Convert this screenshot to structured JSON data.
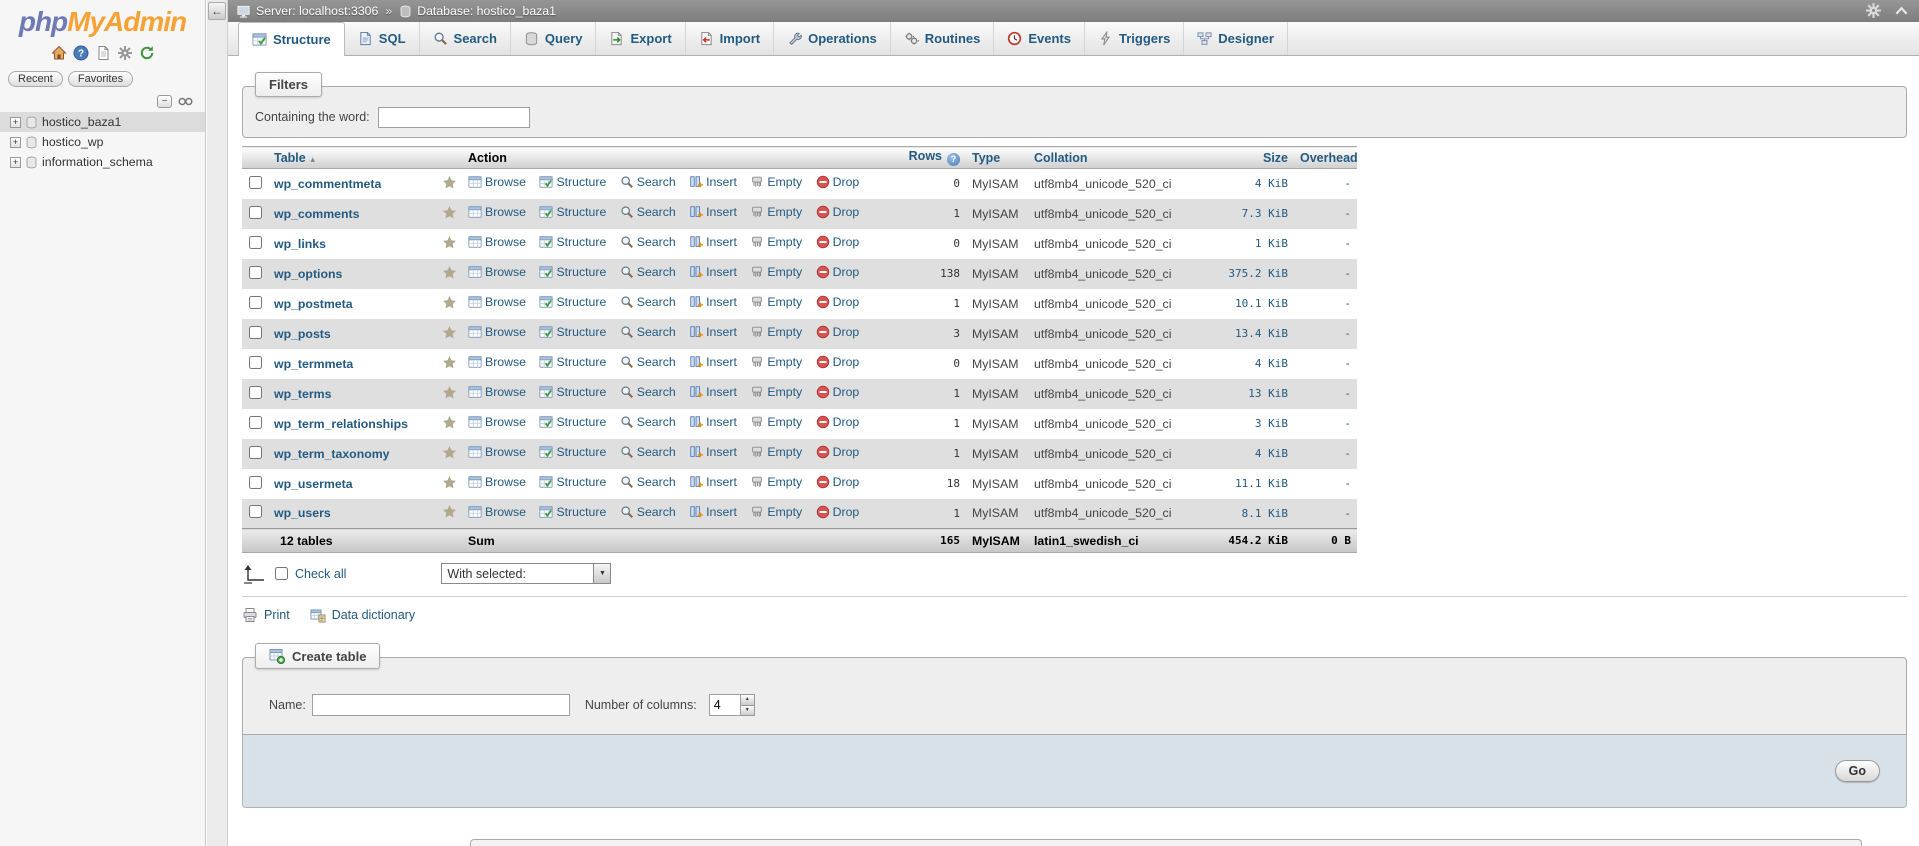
{
  "sidebar": {
    "logo": {
      "php": "php",
      "myadmin": "MyAdmin"
    },
    "buttons": {
      "recent": "Recent",
      "favorites": "Favorites"
    },
    "tools": {
      "collapse_glyph": "−"
    },
    "tree": [
      {
        "label": "hostico_baza1",
        "expander": "+",
        "selected": true
      },
      {
        "label": "hostico_wp",
        "expander": "+",
        "selected": false
      },
      {
        "label": "information_schema",
        "expander": "+",
        "selected": false
      }
    ]
  },
  "topbar": {
    "back_glyph": "←",
    "server": "Server: localhost:3306",
    "separator": "»",
    "database": "Database: hostico_baza1"
  },
  "tabs": [
    {
      "label": "Structure",
      "active": true
    },
    {
      "label": "SQL"
    },
    {
      "label": "Search"
    },
    {
      "label": "Query"
    },
    {
      "label": "Export"
    },
    {
      "label": "Import"
    },
    {
      "label": "Operations"
    },
    {
      "label": "Routines"
    },
    {
      "label": "Events"
    },
    {
      "label": "Triggers"
    },
    {
      "label": "Designer"
    }
  ],
  "filters": {
    "legend": "Filters",
    "label": "Containing the word:",
    "input_value": ""
  },
  "table": {
    "headers": {
      "table": "Table",
      "action": "Action",
      "rows": "Rows",
      "type": "Type",
      "collation": "Collation",
      "size": "Size",
      "overhead": "Overhead"
    },
    "sort_asc_glyph": "▲",
    "rows_help_glyph": "?",
    "action_labels": [
      "Browse",
      "Structure",
      "Search",
      "Insert",
      "Empty",
      "Drop"
    ],
    "rows": [
      {
        "name": "wp_commentmeta",
        "rows": "0",
        "type": "MyISAM",
        "collation": "utf8mb4_unicode_520_ci",
        "size": "4 KiB",
        "overhead": "-"
      },
      {
        "name": "wp_comments",
        "rows": "1",
        "type": "MyISAM",
        "collation": "utf8mb4_unicode_520_ci",
        "size": "7.3 KiB",
        "overhead": "-"
      },
      {
        "name": "wp_links",
        "rows": "0",
        "type": "MyISAM",
        "collation": "utf8mb4_unicode_520_ci",
        "size": "1 KiB",
        "overhead": "-"
      },
      {
        "name": "wp_options",
        "rows": "138",
        "type": "MyISAM",
        "collation": "utf8mb4_unicode_520_ci",
        "size": "375.2 KiB",
        "overhead": "-"
      },
      {
        "name": "wp_postmeta",
        "rows": "1",
        "type": "MyISAM",
        "collation": "utf8mb4_unicode_520_ci",
        "size": "10.1 KiB",
        "overhead": "-"
      },
      {
        "name": "wp_posts",
        "rows": "3",
        "type": "MyISAM",
        "collation": "utf8mb4_unicode_520_ci",
        "size": "13.4 KiB",
        "overhead": "-"
      },
      {
        "name": "wp_termmeta",
        "rows": "0",
        "type": "MyISAM",
        "collation": "utf8mb4_unicode_520_ci",
        "size": "4 KiB",
        "overhead": "-"
      },
      {
        "name": "wp_terms",
        "rows": "1",
        "type": "MyISAM",
        "collation": "utf8mb4_unicode_520_ci",
        "size": "13 KiB",
        "overhead": "-"
      },
      {
        "name": "wp_term_relationships",
        "rows": "1",
        "type": "MyISAM",
        "collation": "utf8mb4_unicode_520_ci",
        "size": "3 KiB",
        "overhead": "-"
      },
      {
        "name": "wp_term_taxonomy",
        "rows": "1",
        "type": "MyISAM",
        "collation": "utf8mb4_unicode_520_ci",
        "size": "4 KiB",
        "overhead": "-"
      },
      {
        "name": "wp_usermeta",
        "rows": "18",
        "type": "MyISAM",
        "collation": "utf8mb4_unicode_520_ci",
        "size": "11.1 KiB",
        "overhead": "-"
      },
      {
        "name": "wp_users",
        "rows": "1",
        "type": "MyISAM",
        "collation": "utf8mb4_unicode_520_ci",
        "size": "8.1 KiB",
        "overhead": "-"
      }
    ],
    "sum": {
      "tables": "12 tables",
      "label": "Sum",
      "rows": "165",
      "type": "MyISAM",
      "collation": "latin1_swedish_ci",
      "size": "454.2 KiB",
      "overhead": "0 B"
    }
  },
  "footer_controls": {
    "check_all": "Check all",
    "with_selected": "With selected:",
    "select_arrow_glyph": "▼"
  },
  "links": {
    "print": "Print",
    "data_dictionary": "Data dictionary"
  },
  "create_table": {
    "legend": "Create table",
    "name_label": "Name:",
    "name_value": "",
    "columns_label": "Number of columns:",
    "columns_value": "4",
    "spin_up_glyph": "▲",
    "spin_down_glyph": "▼",
    "go": "Go"
  },
  "colors": {
    "accent": "#235a81",
    "logo_blue": "#6e79b6",
    "logo_orange": "#f7a234",
    "drop_red": "#d9534f",
    "alt_row": "#dfdfdf",
    "footer_blue": "#d9e1e8"
  }
}
